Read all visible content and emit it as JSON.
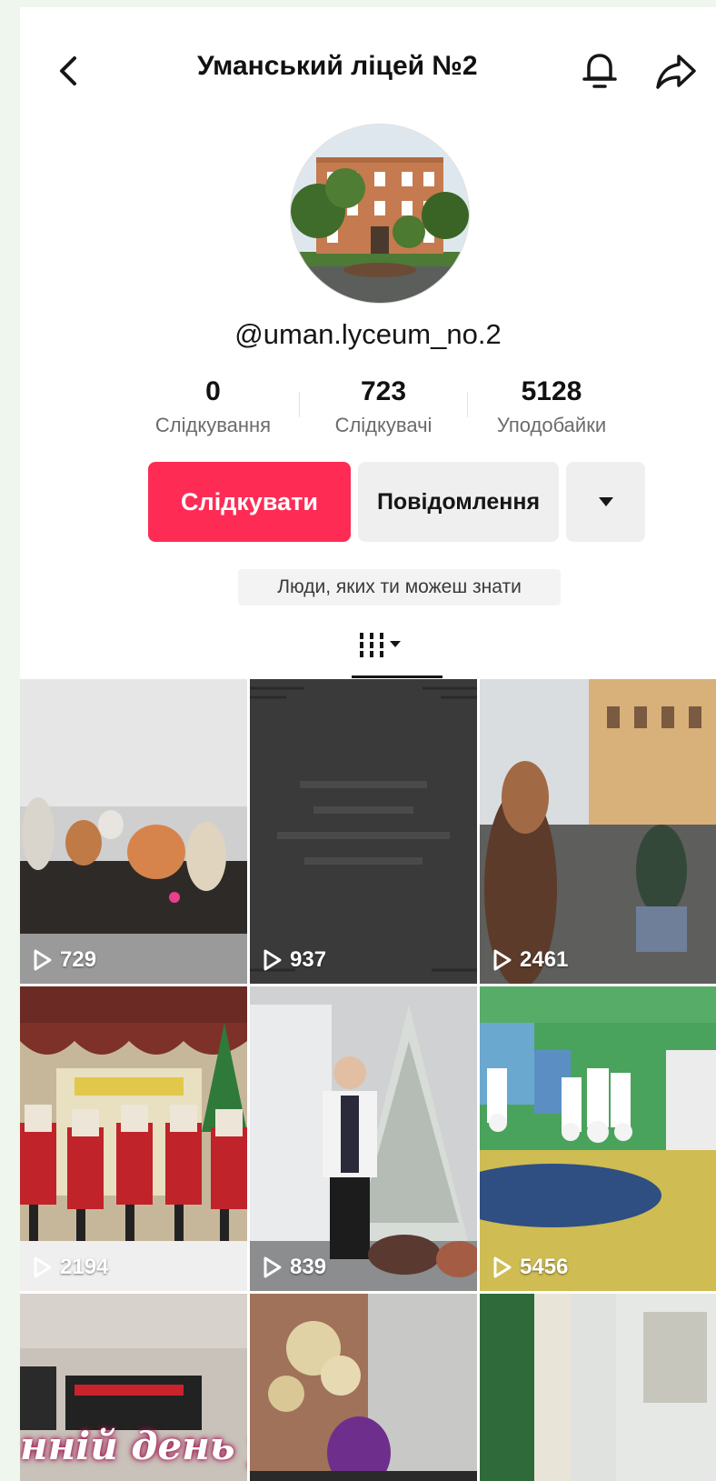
{
  "header": {
    "title": "Уманський ліцей №2",
    "back_icon": "chevron-left-icon",
    "bell_icon": "bell-icon",
    "share_icon": "share-arrow-icon"
  },
  "profile": {
    "handle": "@uman.lyceum_no.2",
    "stats": [
      {
        "value": "0",
        "label": "Слідкування"
      },
      {
        "value": "723",
        "label": "Слідкувачі"
      },
      {
        "value": "5128",
        "label": "Уподобайки"
      }
    ]
  },
  "actions": {
    "follow_label": "Слідкувати",
    "message_label": "Повідомлення",
    "more_icon": "caret-down-icon",
    "suggest_label": "Люди, яких ти можеш знати"
  },
  "colors": {
    "accent": "#fe2c55",
    "secondary_button": "#efefef"
  },
  "videos": [
    {
      "views": "729"
    },
    {
      "views": "937"
    },
    {
      "views": "2461"
    },
    {
      "views": "2194"
    },
    {
      "views": "839"
    },
    {
      "views": "5456"
    },
    {
      "views": "",
      "overlay": "нній день у и"
    },
    {
      "views": ""
    },
    {
      "views": ""
    }
  ]
}
